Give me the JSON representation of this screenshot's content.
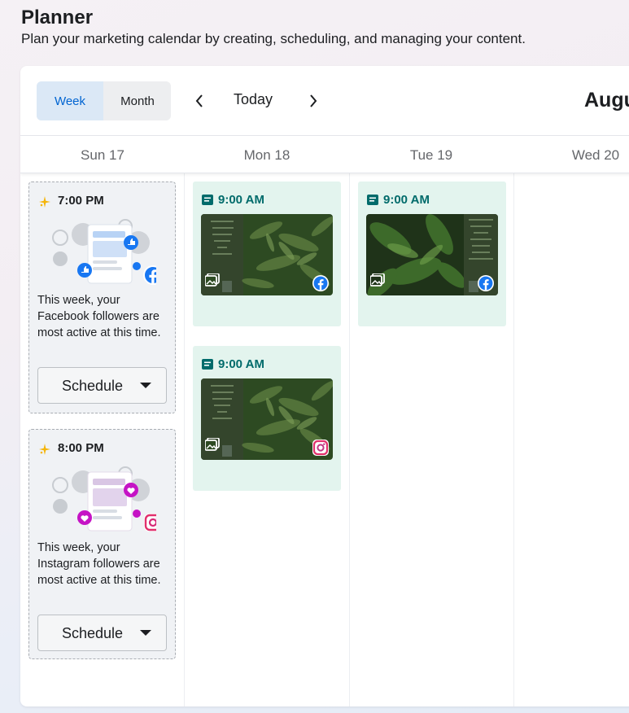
{
  "header": {
    "title": "Planner",
    "subtitle": "Plan your marketing calendar by creating, scheduling, and managing your content."
  },
  "toolbar": {
    "view_week": "Week",
    "view_month": "Month",
    "active_view": "Week",
    "today_label": "Today",
    "month_label": "Augu"
  },
  "days": [
    "Sun 17",
    "Mon 18",
    "Tue 19",
    "Wed 20"
  ],
  "recommendations": [
    {
      "time": "7:00 PM",
      "network": "facebook",
      "text": "This week, your Facebook followers are most active at this time.",
      "button": "Schedule"
    },
    {
      "time": "8:00 PM",
      "network": "instagram",
      "text": "This week, your Instagram followers are most active at this time.",
      "button": "Schedule"
    }
  ],
  "posts": [
    {
      "day": "Mon 18",
      "time": "9:00 AM",
      "network": "facebook",
      "type": "post-icon"
    },
    {
      "day": "Tue 19",
      "time": "9:00 AM",
      "network": "facebook",
      "type": "post-icon"
    },
    {
      "day": "Mon 18",
      "time": "9:00 AM",
      "network": "instagram",
      "type": "post-icon"
    }
  ],
  "colors": {
    "accent": "#0064d1",
    "post_bg": "#e3f4ee",
    "post_time": "#006b6b",
    "facebook": "#1877f2",
    "instagram": "#e1306c",
    "like_purple": "#c513c5"
  }
}
